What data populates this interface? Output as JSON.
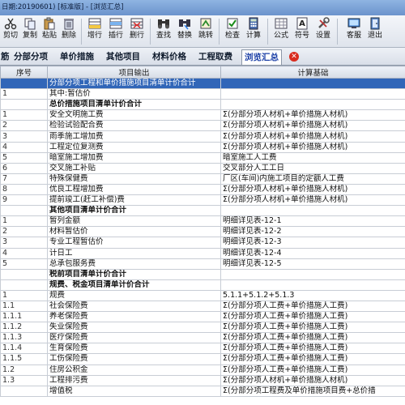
{
  "window": {
    "title": "日期:20190601) [标准版] - [浏览汇总]"
  },
  "toolbar": {
    "buttons": [
      {
        "label": "剪切",
        "icon": "scissors-icon"
      },
      {
        "label": "复制",
        "icon": "copy-icon"
      },
      {
        "label": "粘贴",
        "icon": "paste-icon"
      },
      {
        "label": "删除",
        "icon": "delete-icon"
      },
      {
        "label": "增行",
        "icon": "add-row-icon"
      },
      {
        "label": "插行",
        "icon": "insert-row-icon"
      },
      {
        "label": "删行",
        "icon": "delete-row-icon"
      },
      {
        "label": "查找",
        "icon": "find-icon"
      },
      {
        "label": "替换",
        "icon": "replace-icon"
      },
      {
        "label": "跳转",
        "icon": "jump-icon"
      },
      {
        "label": "检查",
        "icon": "check-icon"
      },
      {
        "label": "计算",
        "icon": "calculate-icon"
      },
      {
        "label": "公式",
        "icon": "formula-icon"
      },
      {
        "label": "符号",
        "icon": "symbol-icon"
      },
      {
        "label": "设置",
        "icon": "settings-icon"
      },
      {
        "label": "客服",
        "icon": "service-icon"
      },
      {
        "label": "退出",
        "icon": "exit-icon"
      }
    ]
  },
  "tabs": [
    {
      "label": "筋"
    },
    {
      "label": "分部分项"
    },
    {
      "label": "单价措施"
    },
    {
      "label": "其他项目"
    },
    {
      "label": "材料价格"
    },
    {
      "label": "工程取费"
    },
    {
      "label": "浏览汇总",
      "active": true
    }
  ],
  "grid": {
    "headers": [
      "序号",
      "项目输出",
      "计算基础"
    ],
    "rows": [
      {
        "code": "",
        "name": "分部分项工程和单价措施项目清单计价合计",
        "basis": "",
        "style": "sel"
      },
      {
        "code": "1",
        "name": "其中:暂估价",
        "basis": ""
      },
      {
        "code": "",
        "name": "总价措施项目清单计价合计",
        "basis": "",
        "style": "bold"
      },
      {
        "code": "1",
        "name": "安全文明施工费",
        "basis": "Σ(分部分项人材机+单价措施人材机)"
      },
      {
        "code": "2",
        "name": "检验试验配合费",
        "basis": "Σ(分部分项人材机+单价措施人材机)"
      },
      {
        "code": "3",
        "name": "雨季施工增加费",
        "basis": "Σ(分部分项人材机+单价措施人材机)"
      },
      {
        "code": "4",
        "name": "工程定位复测费",
        "basis": "Σ(分部分项人材机+单价措施人材机)"
      },
      {
        "code": "5",
        "name": "暗室施工增加费",
        "basis": "暗室施工人工费"
      },
      {
        "code": "6",
        "name": "交叉施工补贴",
        "basis": "交叉部分人工工日"
      },
      {
        "code": "7",
        "name": "特殊保健费",
        "basis": "厂区(车间)内施工项目的定额人工费"
      },
      {
        "code": "8",
        "name": "优良工程增加费",
        "basis": "Σ(分部分项人材机+单价措施人材机)"
      },
      {
        "code": "9",
        "name": "提前竣工(赶工补偿)费",
        "basis": "Σ(分部分项人材机+单价措施人材机)"
      },
      {
        "code": "",
        "name": "其他项目清单计价合计",
        "basis": "",
        "style": "bold"
      },
      {
        "code": "1",
        "name": "暂列金额",
        "basis": "明细详见表-12-1"
      },
      {
        "code": "2",
        "name": "材料暂估价",
        "basis": "明细详见表-12-2"
      },
      {
        "code": "3",
        "name": "专业工程暂估价",
        "basis": "明细详见表-12-3"
      },
      {
        "code": "4",
        "name": "计日工",
        "basis": "明细详见表-12-4"
      },
      {
        "code": "5",
        "name": "总承包服务费",
        "basis": "明细详见表-12-5"
      },
      {
        "code": "",
        "name": "税前项目清单计价合计",
        "basis": "",
        "style": "bold"
      },
      {
        "code": "",
        "name": "规费、税金项目清单计价合计",
        "basis": "",
        "style": "bold"
      },
      {
        "code": "1",
        "name": "规费",
        "basis": "5.1.1+5.1.2+5.1.3"
      },
      {
        "code": "1.1",
        "name": "社会保险费",
        "basis": "Σ(分部分项人工费+单价措施人工费)"
      },
      {
        "code": "1.1.1",
        "name": "养老保险费",
        "basis": "Σ(分部分项人工费+单价措施人工费)"
      },
      {
        "code": "1.1.2",
        "name": "失业保险费",
        "basis": "Σ(分部分项人工费+单价措施人工费)"
      },
      {
        "code": "1.1.3",
        "name": "医疗保险费",
        "basis": "Σ(分部分项人工费+单价措施人工费)"
      },
      {
        "code": "1.1.4",
        "name": "生育保险费",
        "basis": "Σ(分部分项人工费+单价措施人工费)"
      },
      {
        "code": "1.1.5",
        "name": "工伤保险费",
        "basis": "Σ(分部分项人工费+单价措施人工费)"
      },
      {
        "code": "1.2",
        "name": "住房公积金",
        "basis": "Σ(分部分项人工费+单价措施人工费)"
      },
      {
        "code": "1.3",
        "name": "工程排污费",
        "basis": "Σ(分部分项人材机+单价措施人材机)"
      },
      {
        "code": "",
        "name": "增值税",
        "basis": "Σ(分部分项工程费及单价措施项目费+总价措"
      }
    ]
  }
}
